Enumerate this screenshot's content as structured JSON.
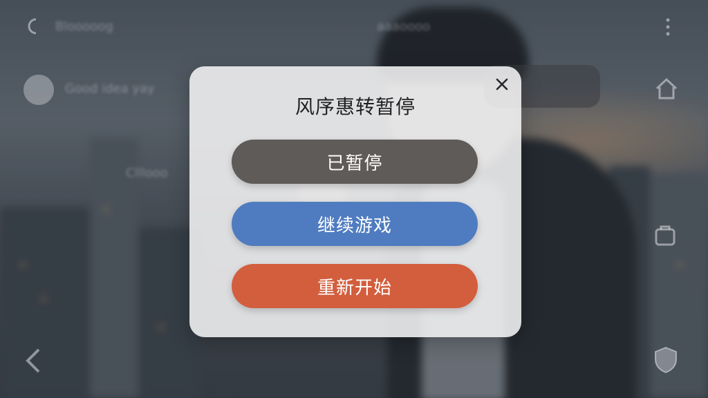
{
  "background": {
    "blurred_label_top_left": "Blooooog",
    "blurred_label_user": "Good idea yay",
    "blurred_label_mid": "Clllooo",
    "blurred_label_top_center": "aaaoooo",
    "icons": [
      "back-arrow-icon",
      "more-vertical-icon",
      "home-icon",
      "chevron-left-icon",
      "bag-icon",
      "shield-icon"
    ]
  },
  "dialog": {
    "title": "风序惠转暂停",
    "close_icon": "close-icon",
    "buttons": {
      "paused": "已暂停",
      "resume": "继续游戏",
      "restart": "重新开始"
    }
  },
  "colors": {
    "paused": "#5f5b58",
    "resume": "#4f7cc0",
    "restart": "#d25e3e",
    "dialog_bg": "#eeeef0"
  }
}
